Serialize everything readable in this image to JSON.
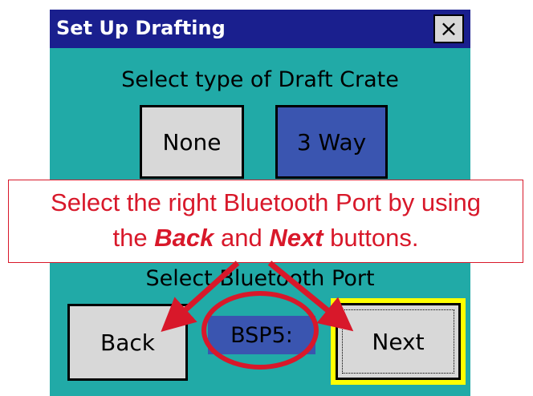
{
  "dialog": {
    "title": "Set Up Drafting",
    "close_icon": "×"
  },
  "draft_crate": {
    "heading": "Select type of Draft Crate",
    "options": [
      "None",
      "3 Way"
    ],
    "selected": "3 Way"
  },
  "callout": {
    "line1": "Select the right Bluetooth Port by using",
    "line2_prefix": "the ",
    "back_word": "Back",
    "middle": " and ",
    "next_word": "Next",
    "line2_suffix": " buttons.",
    "color": "#d8182a"
  },
  "bluetooth": {
    "heading": "Select Bluetooth Port",
    "back_label": "Back",
    "port_value": "BSP5:",
    "next_label": "Next"
  },
  "colors": {
    "window_bg": "#21aaa7",
    "titlebar": "#1a1f8e",
    "selected_button": "#3a55b0",
    "focus_highlight": "#ffff00"
  }
}
